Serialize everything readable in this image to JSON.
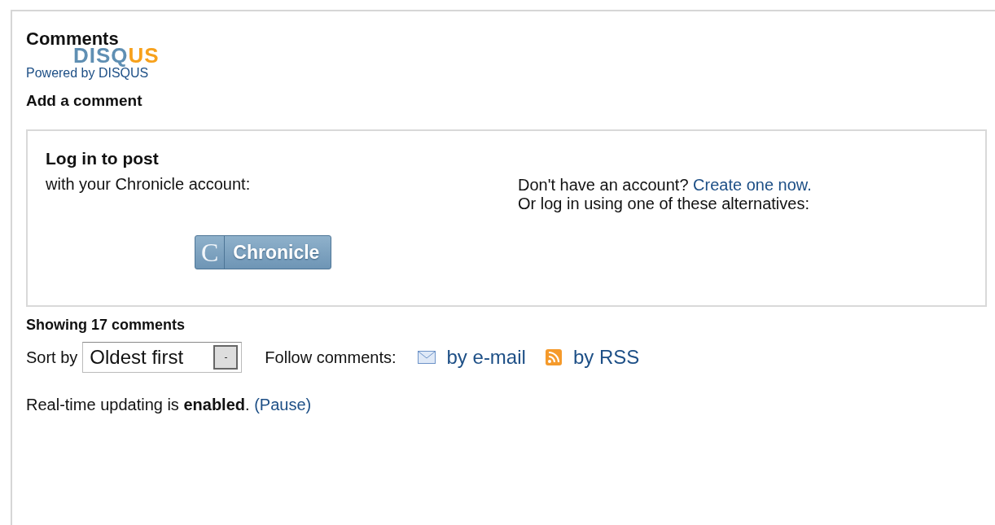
{
  "header": {
    "title": "Comments",
    "logo_parts": [
      "DISQ",
      "US"
    ],
    "powered_by": "Powered by DISQUS"
  },
  "add_comment": {
    "heading": "Add a comment"
  },
  "login": {
    "title": "Log in to post",
    "account_prompt": "with your Chronicle account:",
    "no_account": "Don't have an account?",
    "create_link": "Create one now.",
    "alternatives": "Or log in using one of these alternatives:",
    "button_letter": "C",
    "button_label": "Chronicle"
  },
  "count": "Showing 17 comments",
  "sort": {
    "label": "Sort by",
    "value": "Oldest first"
  },
  "follow": {
    "label": "Follow comments:",
    "links": [
      {
        "kind": "email",
        "label": "by e-mail"
      },
      {
        "kind": "rss",
        "label": "by RSS"
      }
    ]
  },
  "realtime": {
    "text": "Real-time updating is **enabled**.",
    "pause_link": "(Pause)"
  }
}
